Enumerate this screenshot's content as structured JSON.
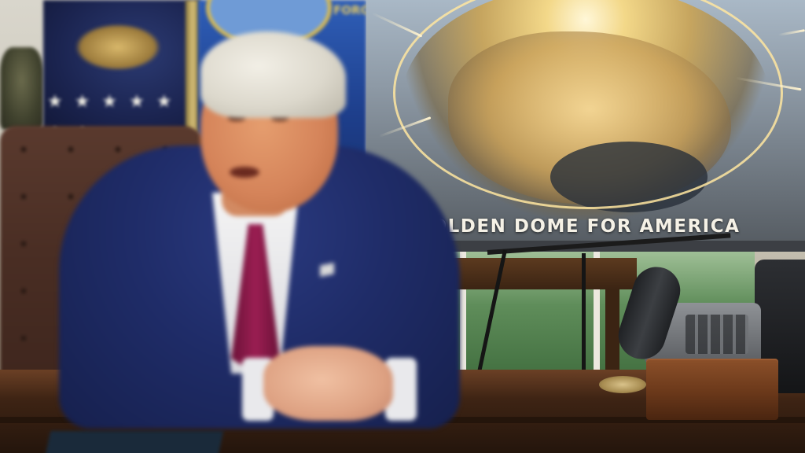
{
  "photo": {
    "poster": {
      "title": "OLDEN DOME FOR AMERICA"
    },
    "flags": {
      "airforce_text": "FORC"
    }
  }
}
